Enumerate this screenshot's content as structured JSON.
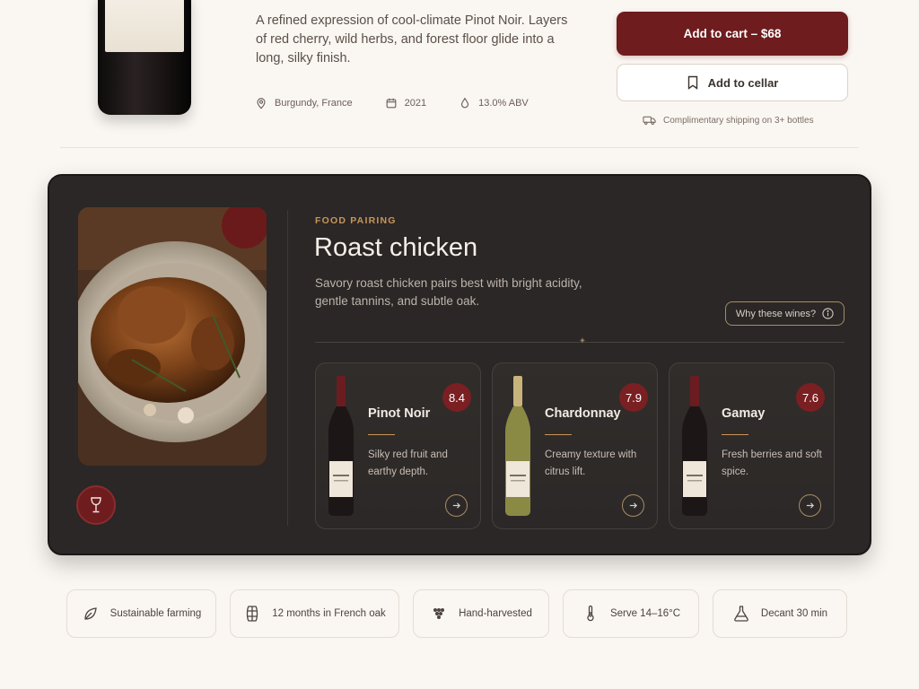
{
  "product": {
    "description": "A refined expression of cool-climate Pinot Noir. Layers of red cherry, wild herbs, and forest floor glide into a long, silky finish.",
    "meta": {
      "region": "Burgundy, France",
      "vintage": "2021",
      "abv": "13.0% ABV"
    },
    "add_to_cart_label": "Add to cart – $68",
    "add_to_cellar_label": "Add to cellar",
    "shipping_note": "Complimentary shipping on 3+ bottles"
  },
  "pairing": {
    "eyebrow": "FOOD PAIRING",
    "title": "Roast chicken",
    "description": "Savory roast chicken pairs best with bright acidity, gentle tannins, and subtle oak.",
    "why_label": "Why these wines?",
    "wines": [
      {
        "name": "Pinot Noir",
        "score": "8.4",
        "description": "Silky red fruit and earthy depth.",
        "bottle": "red"
      },
      {
        "name": "Chardonnay",
        "score": "7.9",
        "description": "Creamy texture with citrus lift.",
        "bottle": "white"
      },
      {
        "name": "Gamay",
        "score": "7.6",
        "description": "Fresh berries and soft spice.",
        "bottle": "red"
      }
    ]
  },
  "features": [
    {
      "label": "Sustainable farming",
      "icon": "leaf-icon"
    },
    {
      "label": "12 months in French oak",
      "icon": "barrel-icon"
    },
    {
      "label": "Hand-harvested",
      "icon": "grapes-icon"
    },
    {
      "label": "Serve 14–16°C",
      "icon": "thermometer-icon"
    },
    {
      "label": "Decant 30 min",
      "icon": "decanter-icon"
    }
  ],
  "colors": {
    "accent": "#6e1c1e",
    "gold": "#c9955a",
    "card_dark": "#2a2726",
    "background": "#faf6f1"
  }
}
